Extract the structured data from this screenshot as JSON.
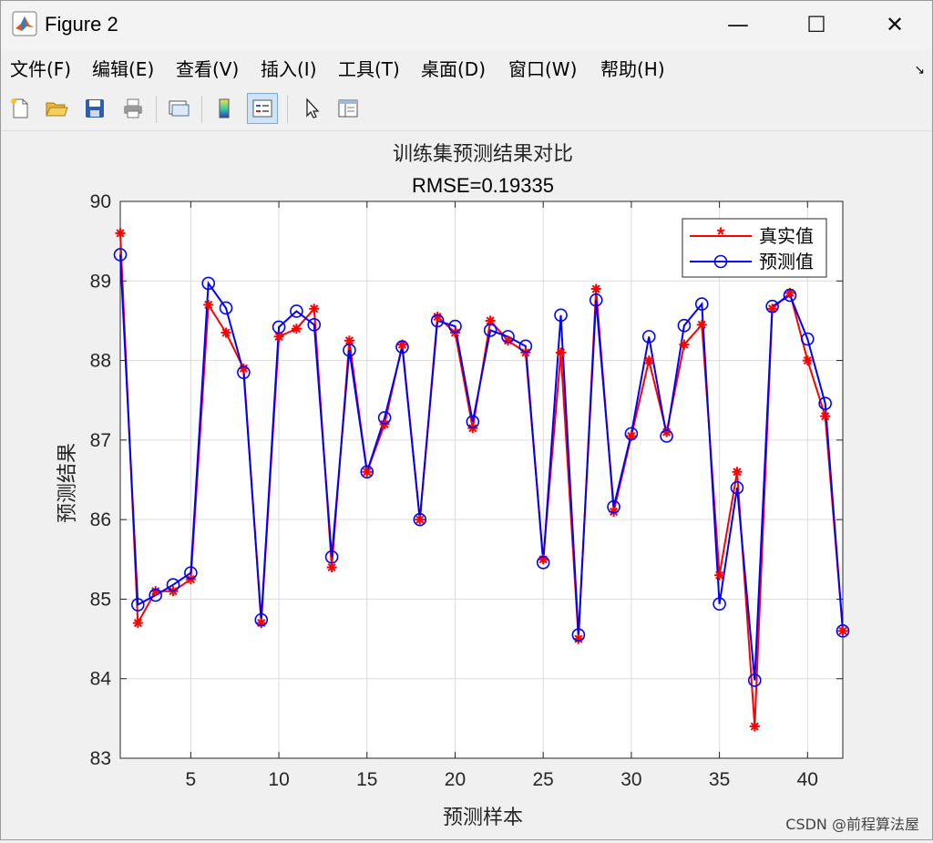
{
  "window": {
    "title": "Figure 2",
    "controls": {
      "minimize": "—",
      "maximize": "☐",
      "close": "✕"
    }
  },
  "menu": {
    "items": [
      {
        "label": "文件(F)"
      },
      {
        "label": "编辑(E)"
      },
      {
        "label": "查看(V)"
      },
      {
        "label": "插入(I)"
      },
      {
        "label": "工具(T)"
      },
      {
        "label": "桌面(D)"
      },
      {
        "label": "窗口(W)"
      },
      {
        "label": "帮助(H)"
      }
    ],
    "overflow_icon": "chevron-arrow-icon"
  },
  "toolbar": {
    "icons": [
      "new-file-icon",
      "open-folder-icon",
      "save-icon",
      "print-icon",
      "link-figure-icon",
      "colorbar-icon",
      "legend-icon",
      "pointer-icon",
      "property-inspector-icon"
    ],
    "active": "legend-icon"
  },
  "chart_data": {
    "type": "line",
    "title": "训练集预测结果对比",
    "subtitle": "RMSE=0.19335",
    "xlabel": "预测样本",
    "ylabel": "预测结果",
    "xlim": [
      1,
      42
    ],
    "ylim": [
      83,
      90
    ],
    "xticks": [
      5,
      10,
      15,
      20,
      25,
      30,
      35,
      40
    ],
    "yticks": [
      83,
      84,
      85,
      86,
      87,
      88,
      89,
      90
    ],
    "grid": true,
    "legend_position": "top-right",
    "x": [
      1,
      2,
      3,
      4,
      5,
      6,
      7,
      8,
      9,
      10,
      11,
      12,
      13,
      14,
      15,
      16,
      17,
      18,
      19,
      20,
      21,
      22,
      23,
      24,
      25,
      26,
      27,
      28,
      29,
      30,
      31,
      32,
      33,
      34,
      35,
      36,
      37,
      38,
      39,
      40,
      41,
      42
    ],
    "series": [
      {
        "name": "真实值",
        "color": "#ff0000",
        "marker": "asterisk",
        "values": [
          89.6,
          84.7,
          85.1,
          85.1,
          85.25,
          88.7,
          88.35,
          87.9,
          84.7,
          88.3,
          88.4,
          88.65,
          85.4,
          88.25,
          86.6,
          87.2,
          88.2,
          86.0,
          88.55,
          88.35,
          87.15,
          88.5,
          88.25,
          88.1,
          85.5,
          88.1,
          84.5,
          88.9,
          86.1,
          87.05,
          88.0,
          87.1,
          88.2,
          88.45,
          85.3,
          86.6,
          83.4,
          88.65,
          88.85,
          88.0,
          87.3,
          84.6
        ]
      },
      {
        "name": "预测值",
        "color": "#0000ff",
        "marker": "circle",
        "values": [
          89.33,
          84.93,
          85.05,
          85.18,
          85.33,
          88.97,
          88.66,
          87.85,
          84.74,
          88.42,
          88.62,
          88.45,
          85.53,
          88.13,
          86.6,
          87.28,
          88.17,
          86.0,
          88.5,
          88.43,
          87.23,
          88.38,
          88.3,
          88.18,
          85.46,
          88.57,
          84.55,
          88.76,
          86.16,
          87.08,
          88.3,
          87.05,
          88.44,
          88.71,
          84.94,
          86.4,
          83.98,
          88.68,
          88.82,
          88.27,
          87.46,
          84.6
        ]
      }
    ]
  },
  "watermark": {
    "text": "CSDN @前程算法屋"
  }
}
